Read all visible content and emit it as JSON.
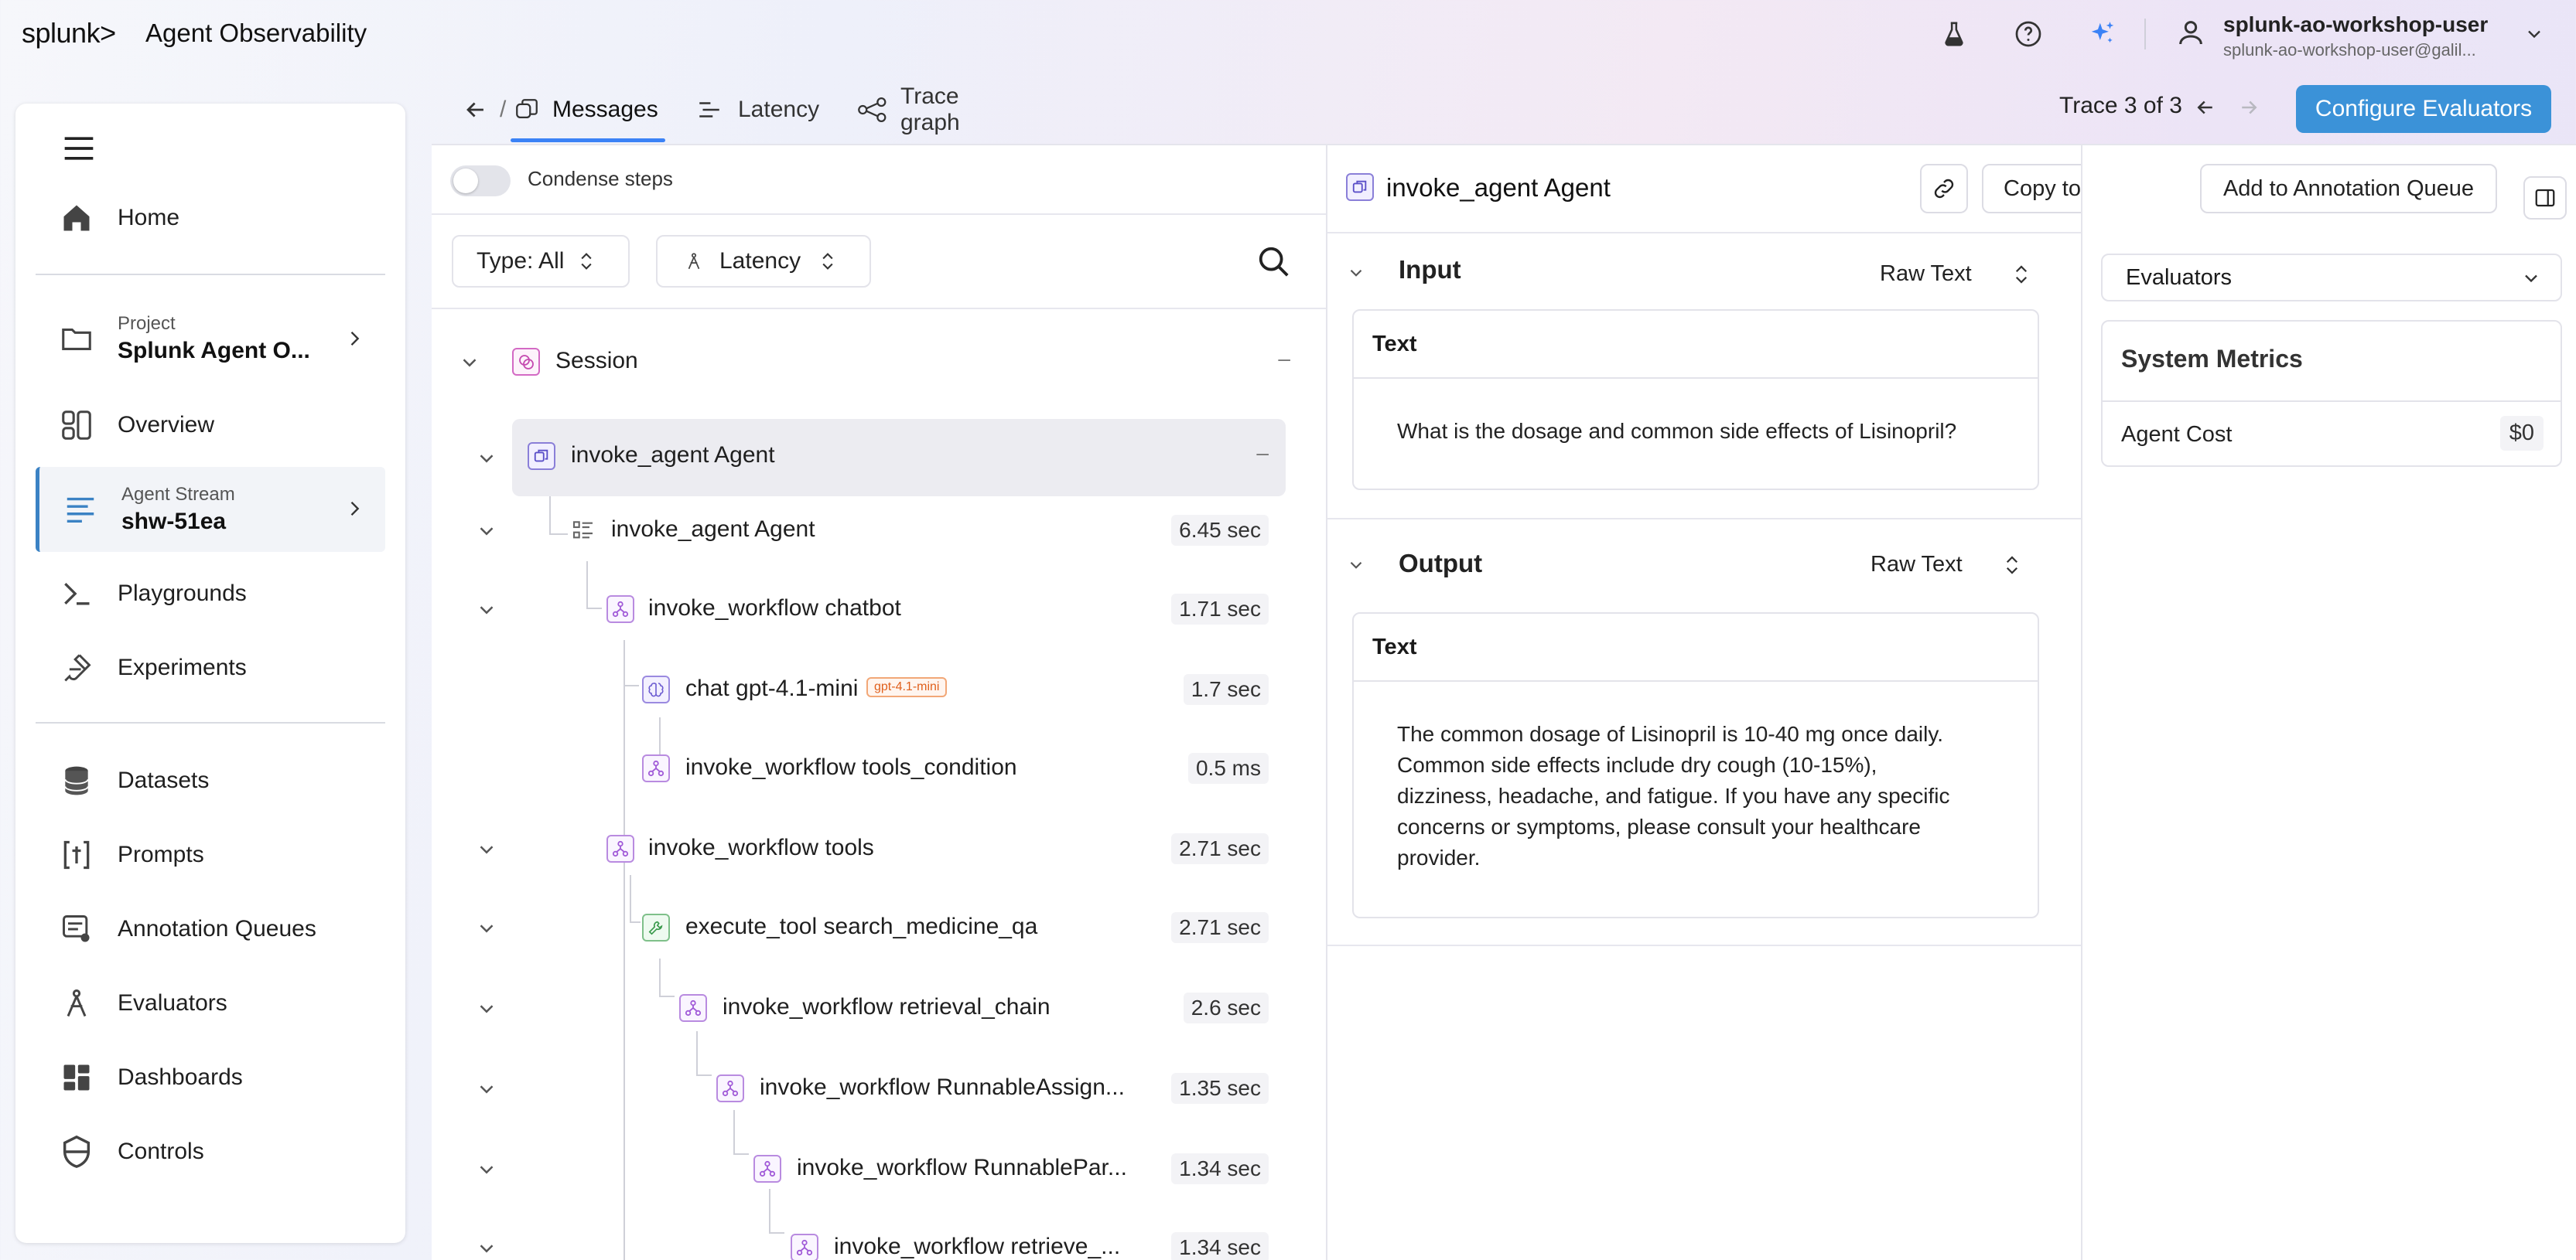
{
  "app": {
    "logo": "splunk>",
    "title": "Agent Observability"
  },
  "user": {
    "name": "splunk-ao-workshop-user",
    "email": "splunk-ao-workshop-user@galil..."
  },
  "sidebar": {
    "items": [
      {
        "label": "Home",
        "icon": "home-icon"
      },
      {
        "small": "Project",
        "big": "Splunk Agent O...",
        "icon": "folder-icon"
      },
      {
        "label": "Overview",
        "icon": "overview-icon"
      },
      {
        "small": "Agent Stream",
        "big": "shw-51ea",
        "icon": "stream-icon"
      },
      {
        "label": "Playgrounds",
        "icon": "terminal-icon"
      },
      {
        "label": "Experiments",
        "icon": "flask-icon"
      },
      {
        "label": "Datasets",
        "icon": "database-icon"
      },
      {
        "label": "Prompts",
        "icon": "prompt-icon"
      },
      {
        "label": "Annotation Queues",
        "icon": "annotation-icon"
      },
      {
        "label": "Evaluators",
        "icon": "evaluator-icon"
      },
      {
        "label": "Dashboards",
        "icon": "dashboard-icon"
      },
      {
        "label": "Controls",
        "icon": "shield-icon"
      }
    ]
  },
  "tabs": {
    "separator": "/",
    "messages": "Messages",
    "latency": "Latency",
    "trace_graph": "Trace graph"
  },
  "trace": {
    "label": "Trace 3 of 3"
  },
  "configure_btn": "Configure Evaluators",
  "left_panel": {
    "condense": "Condense steps",
    "type_filter": "Type: All",
    "latency_filter": "Latency",
    "rows": [
      {
        "name": "Session",
        "time": "–"
      },
      {
        "name": "invoke_agent Agent",
        "time": "–"
      },
      {
        "name": "invoke_agent Agent",
        "time": "6.45 sec"
      },
      {
        "name": "invoke_workflow chatbot",
        "time": "1.71 sec"
      },
      {
        "name": "chat gpt-4.1-mini",
        "time": "1.7 sec",
        "badge": "gpt-4.1-mini"
      },
      {
        "name": "invoke_workflow tools_condition",
        "time": "0.5 ms"
      },
      {
        "name": "invoke_workflow tools",
        "time": "2.71 sec"
      },
      {
        "name": "execute_tool search_medicine_qa",
        "time": "2.71 sec"
      },
      {
        "name": "invoke_workflow retrieval_chain",
        "time": "2.6 sec"
      },
      {
        "name": "invoke_workflow RunnableAssign...",
        "time": "1.35 sec"
      },
      {
        "name": "invoke_workflow RunnablePar...",
        "time": "1.34 sec"
      },
      {
        "name": "invoke_workflow retrieve_...",
        "time": "1.34 sec"
      }
    ]
  },
  "mid_panel": {
    "title": "invoke_agent Agent",
    "copy_btn": "Copy to Dataset",
    "annot_btn": "Add to Annotation Queue",
    "input": {
      "title": "Input",
      "format": "Raw Text",
      "card_head": "Text",
      "text": "What is the dosage and common side effects of Lisinopril?"
    },
    "output": {
      "title": "Output",
      "format": "Raw Text",
      "card_head": "Text",
      "text": "The common dosage of Lisinopril is 10-40 mg once daily. Common side effects include dry cough (10-15%), dizziness, headache, and fatigue. If you have any specific concerns or symptoms, please consult your healthcare provider."
    }
  },
  "right_panel": {
    "evaluators": "Evaluators",
    "metrics_title": "System Metrics",
    "agent_cost_label": "Agent Cost",
    "agent_cost_value": "$0"
  }
}
